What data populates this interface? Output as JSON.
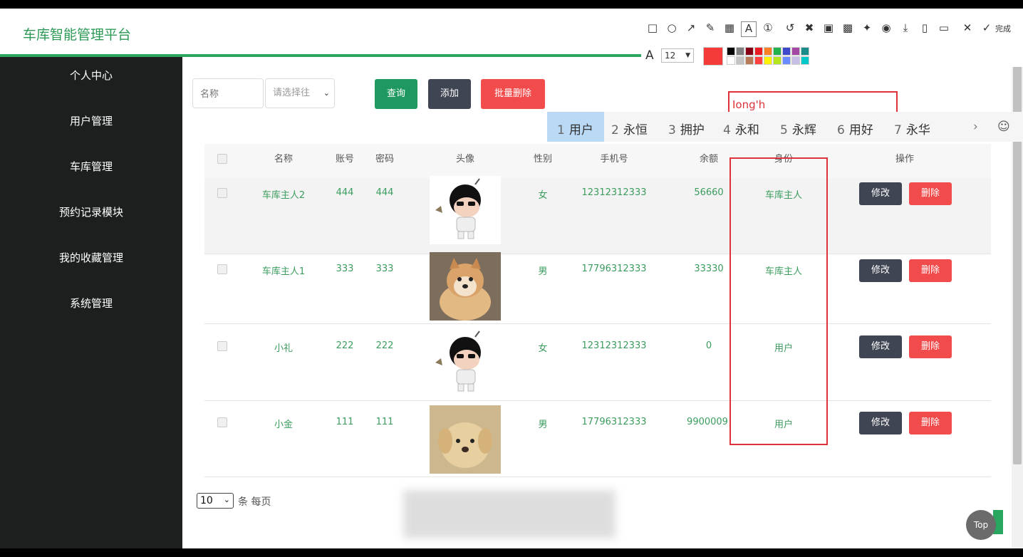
{
  "app_title": "车库智能管理平台",
  "sidebar": {
    "items": [
      {
        "label": "个人中心"
      },
      {
        "label": "用户管理"
      },
      {
        "label": "车库管理"
      },
      {
        "label": "预约记录模块"
      },
      {
        "label": "我的收藏管理"
      },
      {
        "label": "系统管理"
      }
    ]
  },
  "toolbar": {
    "name_placeholder": "名称",
    "select_value": "请选择往",
    "query_label": "查询",
    "add_label": "添加",
    "batch_delete_label": "批量删除"
  },
  "table": {
    "columns": [
      "名称",
      "账号",
      "密码",
      "头像",
      "性别",
      "手机号",
      "余额",
      "身份",
      "操作"
    ],
    "rows": [
      {
        "name": "车库主人2",
        "account": "444",
        "password": "444",
        "gender": "女",
        "phone": "12312312333",
        "balance": "56660",
        "role": "车库主人",
        "avatar": "cartoon-boy"
      },
      {
        "name": "车库主人1",
        "account": "333",
        "password": "333",
        "gender": "男",
        "phone": "17796312333",
        "balance": "33330",
        "role": "车库主人",
        "avatar": "shiba-dog"
      },
      {
        "name": "小礼",
        "account": "222",
        "password": "222",
        "gender": "女",
        "phone": "12312312333",
        "balance": "0",
        "role": "用户",
        "avatar": "cartoon-boy"
      },
      {
        "name": "小金",
        "account": "111",
        "password": "111",
        "gender": "男",
        "phone": "17796312333",
        "balance": "9900009",
        "role": "用户",
        "avatar": "golden-puppy"
      }
    ],
    "edit_label": "修改",
    "delete_label": "删除"
  },
  "pagination": {
    "page_size": "10",
    "per_page_label": "条 每页"
  },
  "ime": {
    "input_text": "Iong'h",
    "candidates": [
      {
        "num": "1",
        "word": "用户"
      },
      {
        "num": "2",
        "word": "永恒"
      },
      {
        "num": "3",
        "word": "拥护"
      },
      {
        "num": "4",
        "word": "永和"
      },
      {
        "num": "5",
        "word": "永辉"
      },
      {
        "num": "6",
        "word": "用好"
      },
      {
        "num": "7",
        "word": "永华"
      }
    ]
  },
  "annotation": {
    "font_size": "12",
    "done_label": "完成",
    "active_color": "#f53a3a",
    "palette": [
      "#000000",
      "#7f7f7f",
      "#880015",
      "#ed1c24",
      "#ff7f27",
      "#22b14c",
      "#3f48cc",
      "#a349a4",
      "#1a8a8a",
      "#ffffff",
      "#c3c3c3",
      "#b97a57",
      "#ff4040",
      "#fff200",
      "#b5e61d",
      "#6a8cff",
      "#c8bfe7",
      "#00c8c8"
    ]
  },
  "top_label": "Top",
  "colors": {
    "brand_green": "#2c9a55",
    "query_green": "#1f9960",
    "dark_button": "#3f4552",
    "danger_red": "#f24b4b",
    "sidebar_bg": "#1d1f1f"
  }
}
